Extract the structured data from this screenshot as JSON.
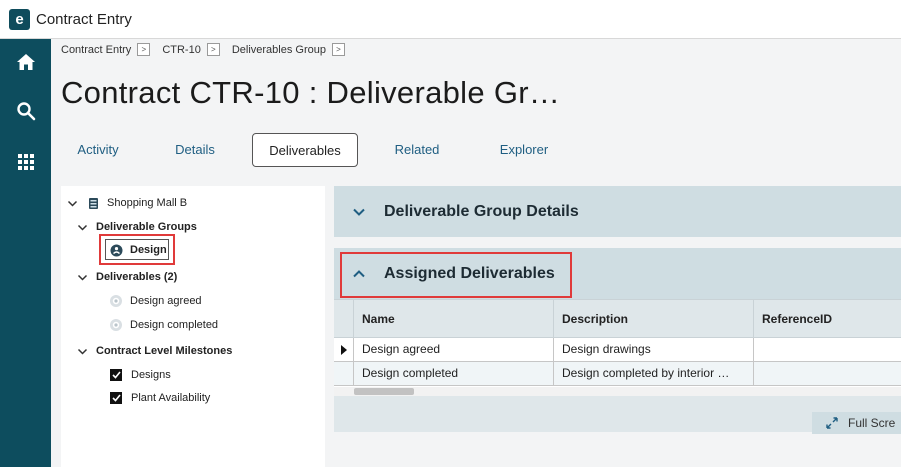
{
  "app": {
    "logo_letter": "e",
    "title": "Contract Entry"
  },
  "rail": {
    "items": [
      "home-icon",
      "search-icon",
      "grid-apps-icon"
    ]
  },
  "breadcrumb": [
    {
      "label": "Contract Entry"
    },
    {
      "label": "CTR-10"
    },
    {
      "label": "Deliverables Group"
    }
  ],
  "page": {
    "title": "Contract CTR-10 : Deliverable Gr…"
  },
  "tabs": [
    {
      "label": "Activity"
    },
    {
      "label": "Details"
    },
    {
      "label": "Deliverables",
      "active": true
    },
    {
      "label": "Related"
    },
    {
      "label": "Explorer"
    }
  ],
  "tree": {
    "root": {
      "label": "Shopping Mall B"
    },
    "deliverable_groups": {
      "label": "Deliverable Groups",
      "items": [
        {
          "label": "Design"
        }
      ]
    },
    "deliverables": {
      "label": "Deliverables (2)",
      "items": [
        {
          "label": "Design agreed"
        },
        {
          "label": "Design completed"
        }
      ]
    },
    "milestones": {
      "label": "Contract Level Milestones",
      "items": [
        {
          "label": "Designs",
          "checked": true
        },
        {
          "label": "Plant Availability",
          "checked": true
        }
      ]
    }
  },
  "panels": {
    "group_details": {
      "title": "Deliverable Group Details"
    },
    "assigned": {
      "title": "Assigned Deliverables"
    }
  },
  "grid": {
    "columns": [
      "Name",
      "Description",
      "ReferenceID"
    ],
    "rows": [
      {
        "name": "Design agreed",
        "description": "Design drawings",
        "reference": ""
      },
      {
        "name": "Design completed",
        "description": "Design completed by interior …",
        "reference": ""
      }
    ],
    "fullscreen_label": "Full Scre"
  },
  "colors": {
    "rail": "#0d4d5e",
    "accent_link": "#1f5e82",
    "panel_header": "#cfdde2",
    "highlight": "#e03a3a"
  }
}
